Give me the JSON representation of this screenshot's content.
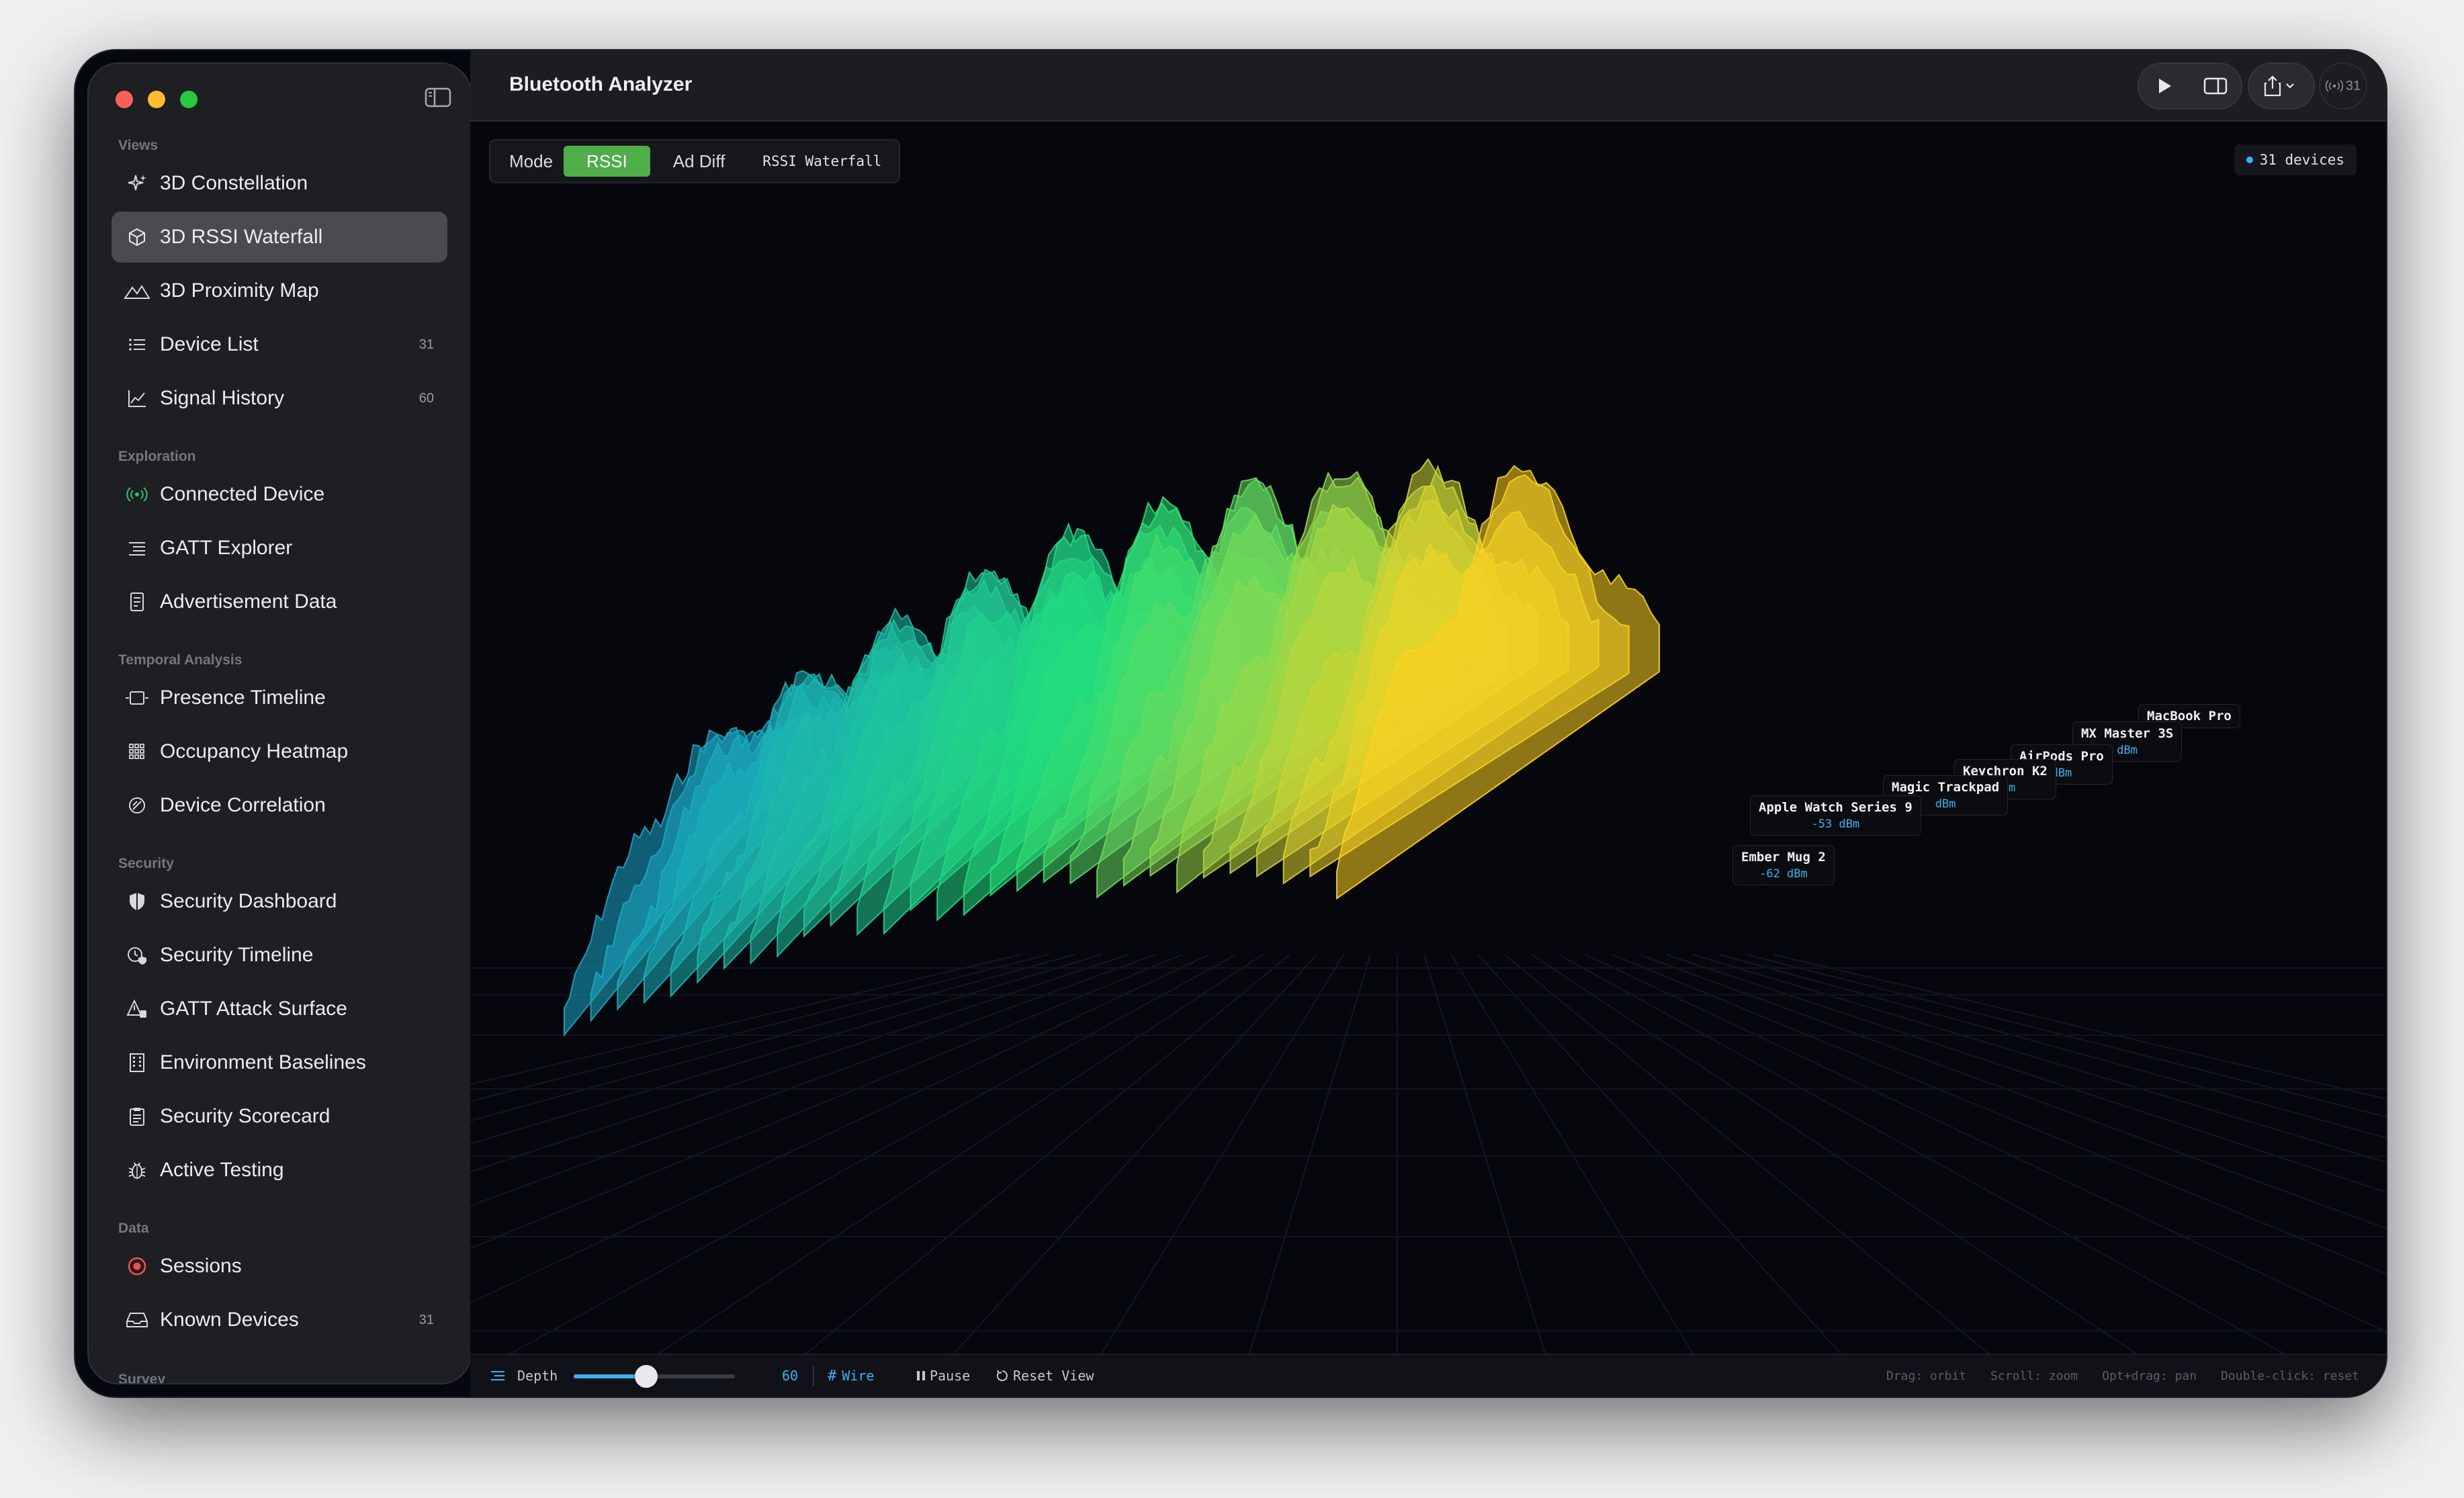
{
  "app": {
    "title": "Bluetooth Analyzer"
  },
  "toolbar": {
    "device_count": "31"
  },
  "sidebar": {
    "sections": [
      {
        "label": "Views",
        "items": [
          {
            "label": "3D Constellation",
            "icon": "sparkles-icon"
          },
          {
            "label": "3D RSSI Waterfall",
            "icon": "cube-icon",
            "selected": true
          },
          {
            "label": "3D Proximity Map",
            "icon": "mountains-icon"
          },
          {
            "label": "Device List",
            "icon": "list-icon",
            "count": "31"
          },
          {
            "label": "Signal History",
            "icon": "line-chart-icon",
            "count": "60"
          }
        ]
      },
      {
        "label": "Exploration",
        "items": [
          {
            "label": "Connected Device",
            "icon": "antenna-icon"
          },
          {
            "label": "GATT Explorer",
            "icon": "indented-list-icon"
          },
          {
            "label": "Advertisement Data",
            "icon": "document-icon"
          }
        ]
      },
      {
        "label": "Temporal Analysis",
        "items": [
          {
            "label": "Presence Timeline",
            "icon": "timeline-icon"
          },
          {
            "label": "Occupancy Heatmap",
            "icon": "grid-icon"
          },
          {
            "label": "Device Correlation",
            "icon": "correlation-icon"
          }
        ]
      },
      {
        "label": "Security",
        "items": [
          {
            "label": "Security Dashboard",
            "icon": "shield-icon"
          },
          {
            "label": "Security Timeline",
            "icon": "clock-shield-icon"
          },
          {
            "label": "GATT Attack Surface",
            "icon": "warning-icon"
          },
          {
            "label": "Environment Baselines",
            "icon": "building-icon"
          },
          {
            "label": "Security Scorecard",
            "icon": "clipboard-icon"
          },
          {
            "label": "Active Testing",
            "icon": "bug-icon"
          }
        ]
      },
      {
        "label": "Data",
        "items": [
          {
            "label": "Sessions",
            "icon": "record-icon"
          },
          {
            "label": "Known Devices",
            "icon": "tray-icon",
            "count": "31"
          }
        ]
      },
      {
        "label": "Survey",
        "items": []
      }
    ]
  },
  "mode": {
    "label": "Mode",
    "options": [
      "RSSI",
      "Ad Diff"
    ],
    "selected": "RSSI",
    "view_name": "RSSI Waterfall"
  },
  "devices_badge": "31 devices",
  "device_labels": [
    {
      "name": "MacBook Pro",
      "rssi": ""
    },
    {
      "name": "MX Master 3S",
      "rssi": "dBm"
    },
    {
      "name": "AirPods Pro",
      "rssi": "dBm"
    },
    {
      "name": "Keychron K2",
      "rssi": "dBm"
    },
    {
      "name": "Magic Trackpad",
      "rssi": "dBm"
    },
    {
      "name": "Apple Watch Series 9",
      "rssi": "-53 dBm"
    },
    {
      "name": "Ember Mug 2",
      "rssi": "-62 dBm"
    }
  ],
  "bottombar": {
    "depth_label": "Depth",
    "depth_value": "60",
    "depth_fraction": 0.45,
    "wire_label": "Wire",
    "pause_label": "Pause",
    "reset_label": "Reset View",
    "hints": [
      "Drag: orbit",
      "Scroll: zoom",
      "Opt+drag: pan",
      "Double-click: reset"
    ]
  },
  "colors": {
    "accent": "#35b4f0",
    "mode_active": "#4fae4a",
    "waterfall_low": "#1aa6c8",
    "waterfall_mid": "#22e07a",
    "waterfall_high": "#ffd21f"
  }
}
